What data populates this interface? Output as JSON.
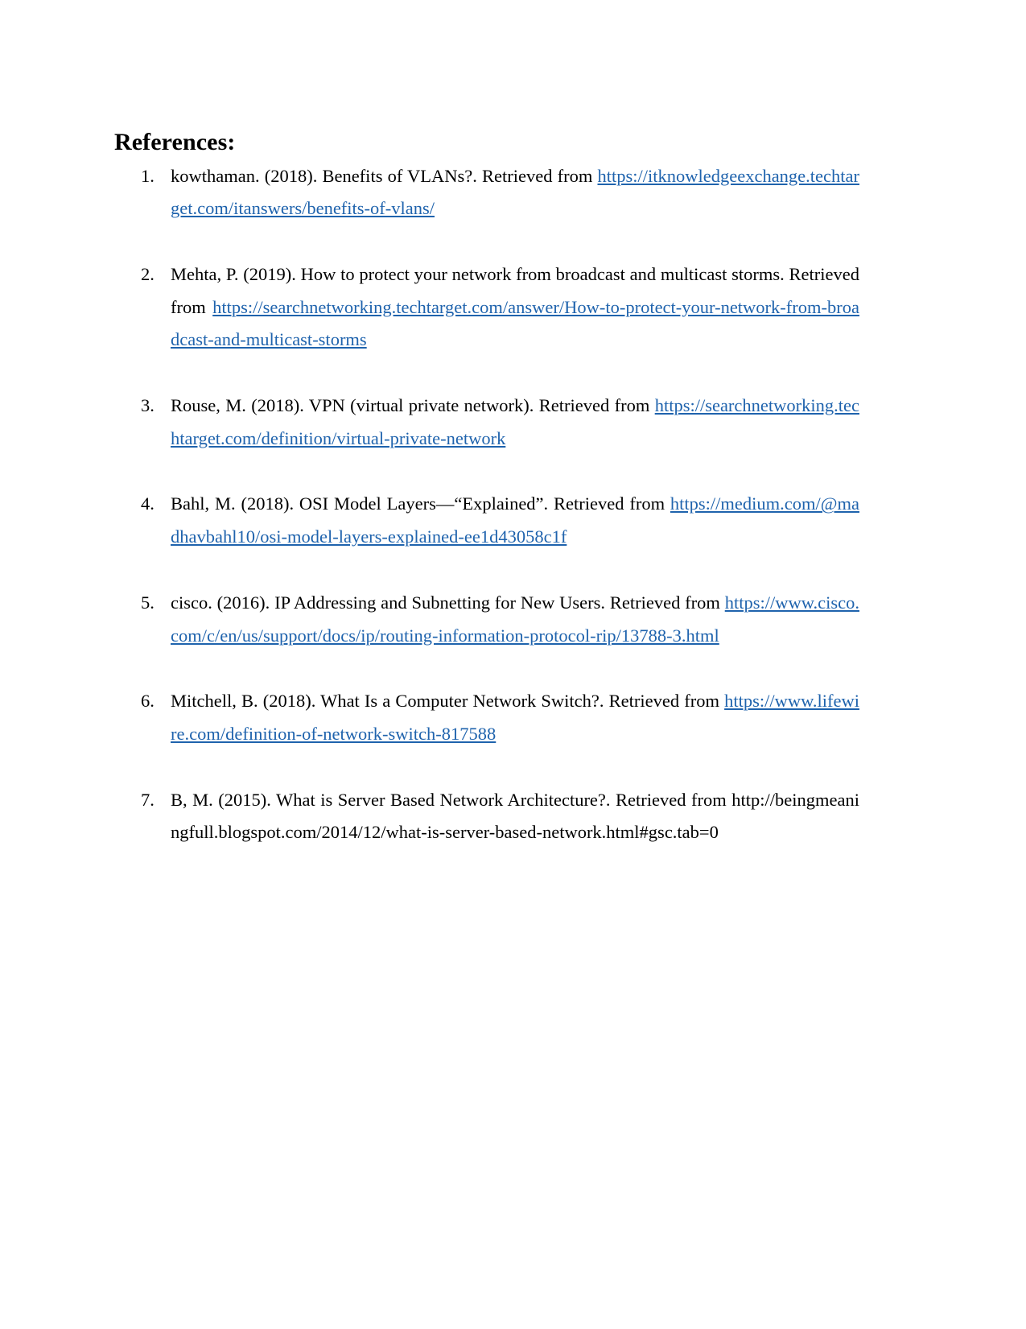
{
  "document": {
    "heading": "References:",
    "link_color": "#1f63ad",
    "text_color": "#000000",
    "page_background": "#ffffff"
  },
  "references": [
    {
      "number": "1.",
      "text": "kowthaman. (2018). Benefits of VLANs?. Retrieved from ",
      "url": "https://itknowledgeexchange.techtarget.com/itanswers/benefits-of-vlans/",
      "url_is_link": true,
      "trailing": ""
    },
    {
      "number": "2.",
      "text": "Mehta, P. (2019). How to protect your network from broadcast and multicast storms. Retrieved from  ",
      "url": "https://searchnetworking.techtarget.com/answer/How-to-protect-your-network-from-broadcast-and-multicast-storms",
      "url_is_link": true,
      "trailing": ""
    },
    {
      "number": "3.",
      "text": "Rouse, M. (2018). VPN (virtual private network). Retrieved from ",
      "url": "https://searchnetworking.techtarget.com/definition/virtual-private-network",
      "url_is_link": true,
      "trailing": ""
    },
    {
      "number": "4.",
      "text": "Bahl, M. (2018). OSI Model Layers—“Explained”. Retrieved from ",
      "url": "https://medium.com/@madhavbahl10/osi-model-layers-explained-ee1d43058c1f",
      "url_is_link": true,
      "trailing": ""
    },
    {
      "number": "5.",
      "text": "cisco. (2016). IP Addressing and Subnetting for New Users. Retrieved from ",
      "url": "https://www.cisco.com/c/en/us/support/docs/ip/routing-information-protocol-rip/13788-3.html",
      "url_is_link": true,
      "trailing": ""
    },
    {
      "number": "6.",
      "text": "Mitchell, B. (2018). What Is a Computer Network Switch?. Retrieved from ",
      "url": "https://www.lifewire.com/definition-of-network-switch-817588",
      "url_is_link": true,
      "trailing": ""
    },
    {
      "number": "7.",
      "text": "B, M. (2015). What is Server Based Network Architecture?. Retrieved from ",
      "url": "http://beingmeaningfull.blogspot.com/2014/12/what-is-server-based-network.html#gsc.tab=0",
      "url_is_link": false,
      "trailing": ""
    }
  ]
}
